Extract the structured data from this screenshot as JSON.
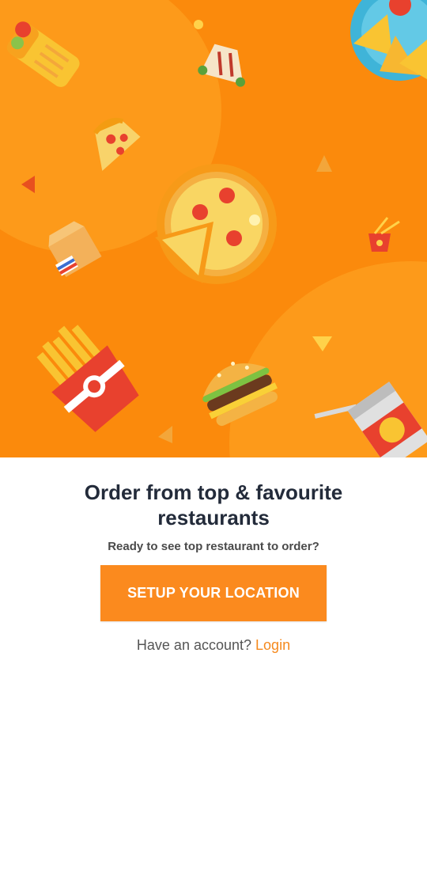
{
  "hero": {
    "illustration": "food-pattern",
    "colors": {
      "background": "#fb8a0c",
      "blob": "#fd9a1a"
    }
  },
  "onboarding": {
    "title": "Order from top & favourite restaurants",
    "subtitle": "Ready to see top restaurant to order?",
    "cta_label": "SETUP YOUR LOCATION",
    "account_prompt": "Have an account?",
    "login_label": "Login"
  },
  "colors": {
    "accent": "#fb8a1e",
    "title": "#232b3a"
  }
}
